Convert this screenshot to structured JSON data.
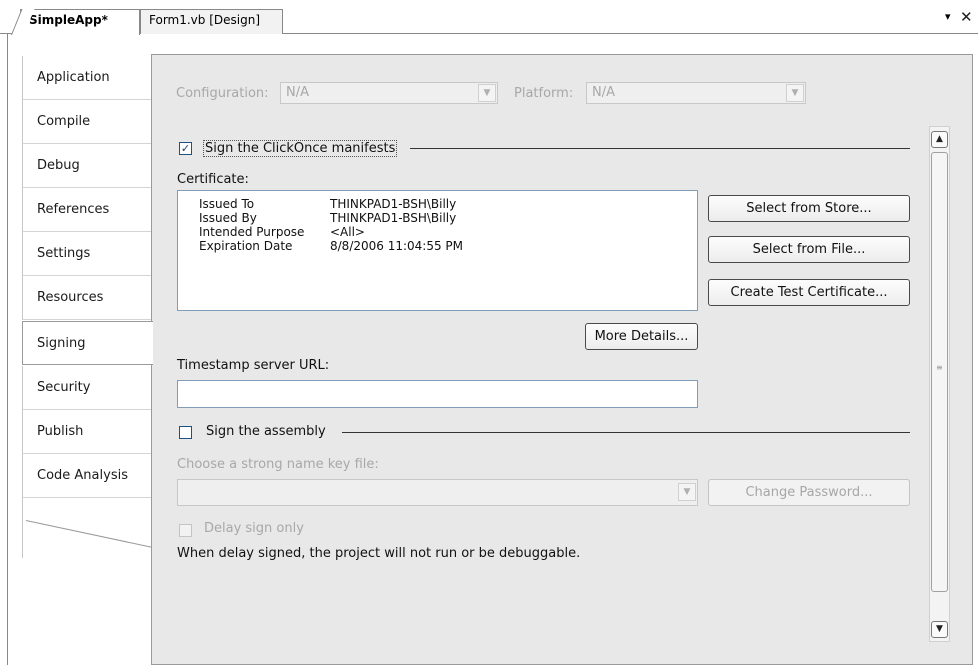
{
  "tabs": [
    {
      "label": "SimpleApp*"
    },
    {
      "label": "Form1.vb [Design]"
    }
  ],
  "tabstrip": {
    "menu_glyph": "▾",
    "close_glyph": "✕"
  },
  "sidebar": {
    "items": [
      {
        "label": "Application"
      },
      {
        "label": "Compile"
      },
      {
        "label": "Debug"
      },
      {
        "label": "References"
      },
      {
        "label": "Settings"
      },
      {
        "label": "Resources"
      },
      {
        "label": "Signing"
      },
      {
        "label": "Security"
      },
      {
        "label": "Publish"
      },
      {
        "label": "Code Analysis"
      }
    ],
    "active": "Signing"
  },
  "config": {
    "configuration_label": "Configuration:",
    "configuration_value": "N/A",
    "platform_label": "Platform:",
    "platform_value": "N/A"
  },
  "signing": {
    "clickonce_label": "Sign the ClickOnce manifests",
    "clickonce_checked": true,
    "certificate_label": "Certificate:",
    "certificate": {
      "issued_to_key": "Issued To",
      "issued_to": "THINKPAD1-BSH\\Billy",
      "issued_by_key": "Issued By",
      "issued_by": "THINKPAD1-BSH\\Billy",
      "purpose_key": "Intended Purpose",
      "purpose": "<All>",
      "expiration_key": "Expiration Date",
      "expiration": "8/8/2006 11:04:55 PM"
    },
    "select_store_label": "Select from Store...",
    "select_file_label": "Select from File...",
    "create_test_label": "Create Test Certificate...",
    "more_details_label": "More Details...",
    "timestamp_label": "Timestamp server URL:",
    "timestamp_value": "",
    "assembly_label": "Sign the assembly",
    "assembly_checked": false,
    "key_file_label": "Choose a strong name key file:",
    "key_file_value": "",
    "change_password_label": "Change Password...",
    "delay_sign_label": "Delay sign only",
    "delay_note": "When delay signed, the project will not run or be debuggable."
  },
  "colors": {
    "panel_bg": "#e8e8e8",
    "disabled_text": "#a8a8a8",
    "field_border": "#7f9db9"
  }
}
